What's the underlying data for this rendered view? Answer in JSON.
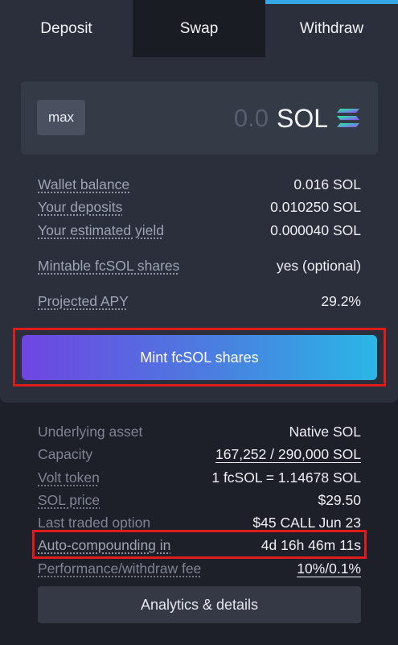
{
  "tabs": [
    {
      "label": "Deposit"
    },
    {
      "label": "Swap"
    },
    {
      "label": "Withdraw",
      "active": true
    }
  ],
  "amount": {
    "max_label": "max",
    "placeholder": "0.0",
    "unit": "SOL",
    "token_icon": "solana-logo-icon"
  },
  "stats": {
    "wallet_balance": {
      "label": "Wallet balance",
      "value": "0.016 SOL"
    },
    "your_deposits": {
      "label": "Your deposits",
      "value": "0.010250 SOL"
    },
    "estimated_yield": {
      "label": "Your estimated yield",
      "value": "0.000040 SOL"
    },
    "mintable_shares": {
      "label": "Mintable fcSOL shares",
      "value": "yes (optional)"
    },
    "projected_apy": {
      "label": "Projected APY",
      "value": "29.2%"
    }
  },
  "mint_button": {
    "label": "Mint fcSOL shares"
  },
  "info": {
    "underlying_asset": {
      "label": "Underlying asset",
      "value": "Native SOL"
    },
    "capacity": {
      "label": "Capacity",
      "value": "167,252 / 290,000 SOL"
    },
    "volt_token": {
      "label": "Volt token",
      "value": "1 fcSOL = 1.14678 SOL"
    },
    "sol_price": {
      "label": "SOL price",
      "value": "$29.50"
    },
    "last_traded_option": {
      "label": "Last traded option",
      "value": "$45 CALL Jun 23"
    },
    "auto_compounding": {
      "label": "Auto-compounding in",
      "value": "4d 16h 46m 11s"
    },
    "fee": {
      "label": "Performance/withdraw fee",
      "value": "10%/0.1%"
    }
  },
  "analytics_button": {
    "label": "Analytics & details"
  },
  "colors": {
    "accent": "#35a7e6",
    "gradient_start": "#6f45e2",
    "gradient_end": "#2bb6e6",
    "highlight_border": "#e01b1b"
  }
}
